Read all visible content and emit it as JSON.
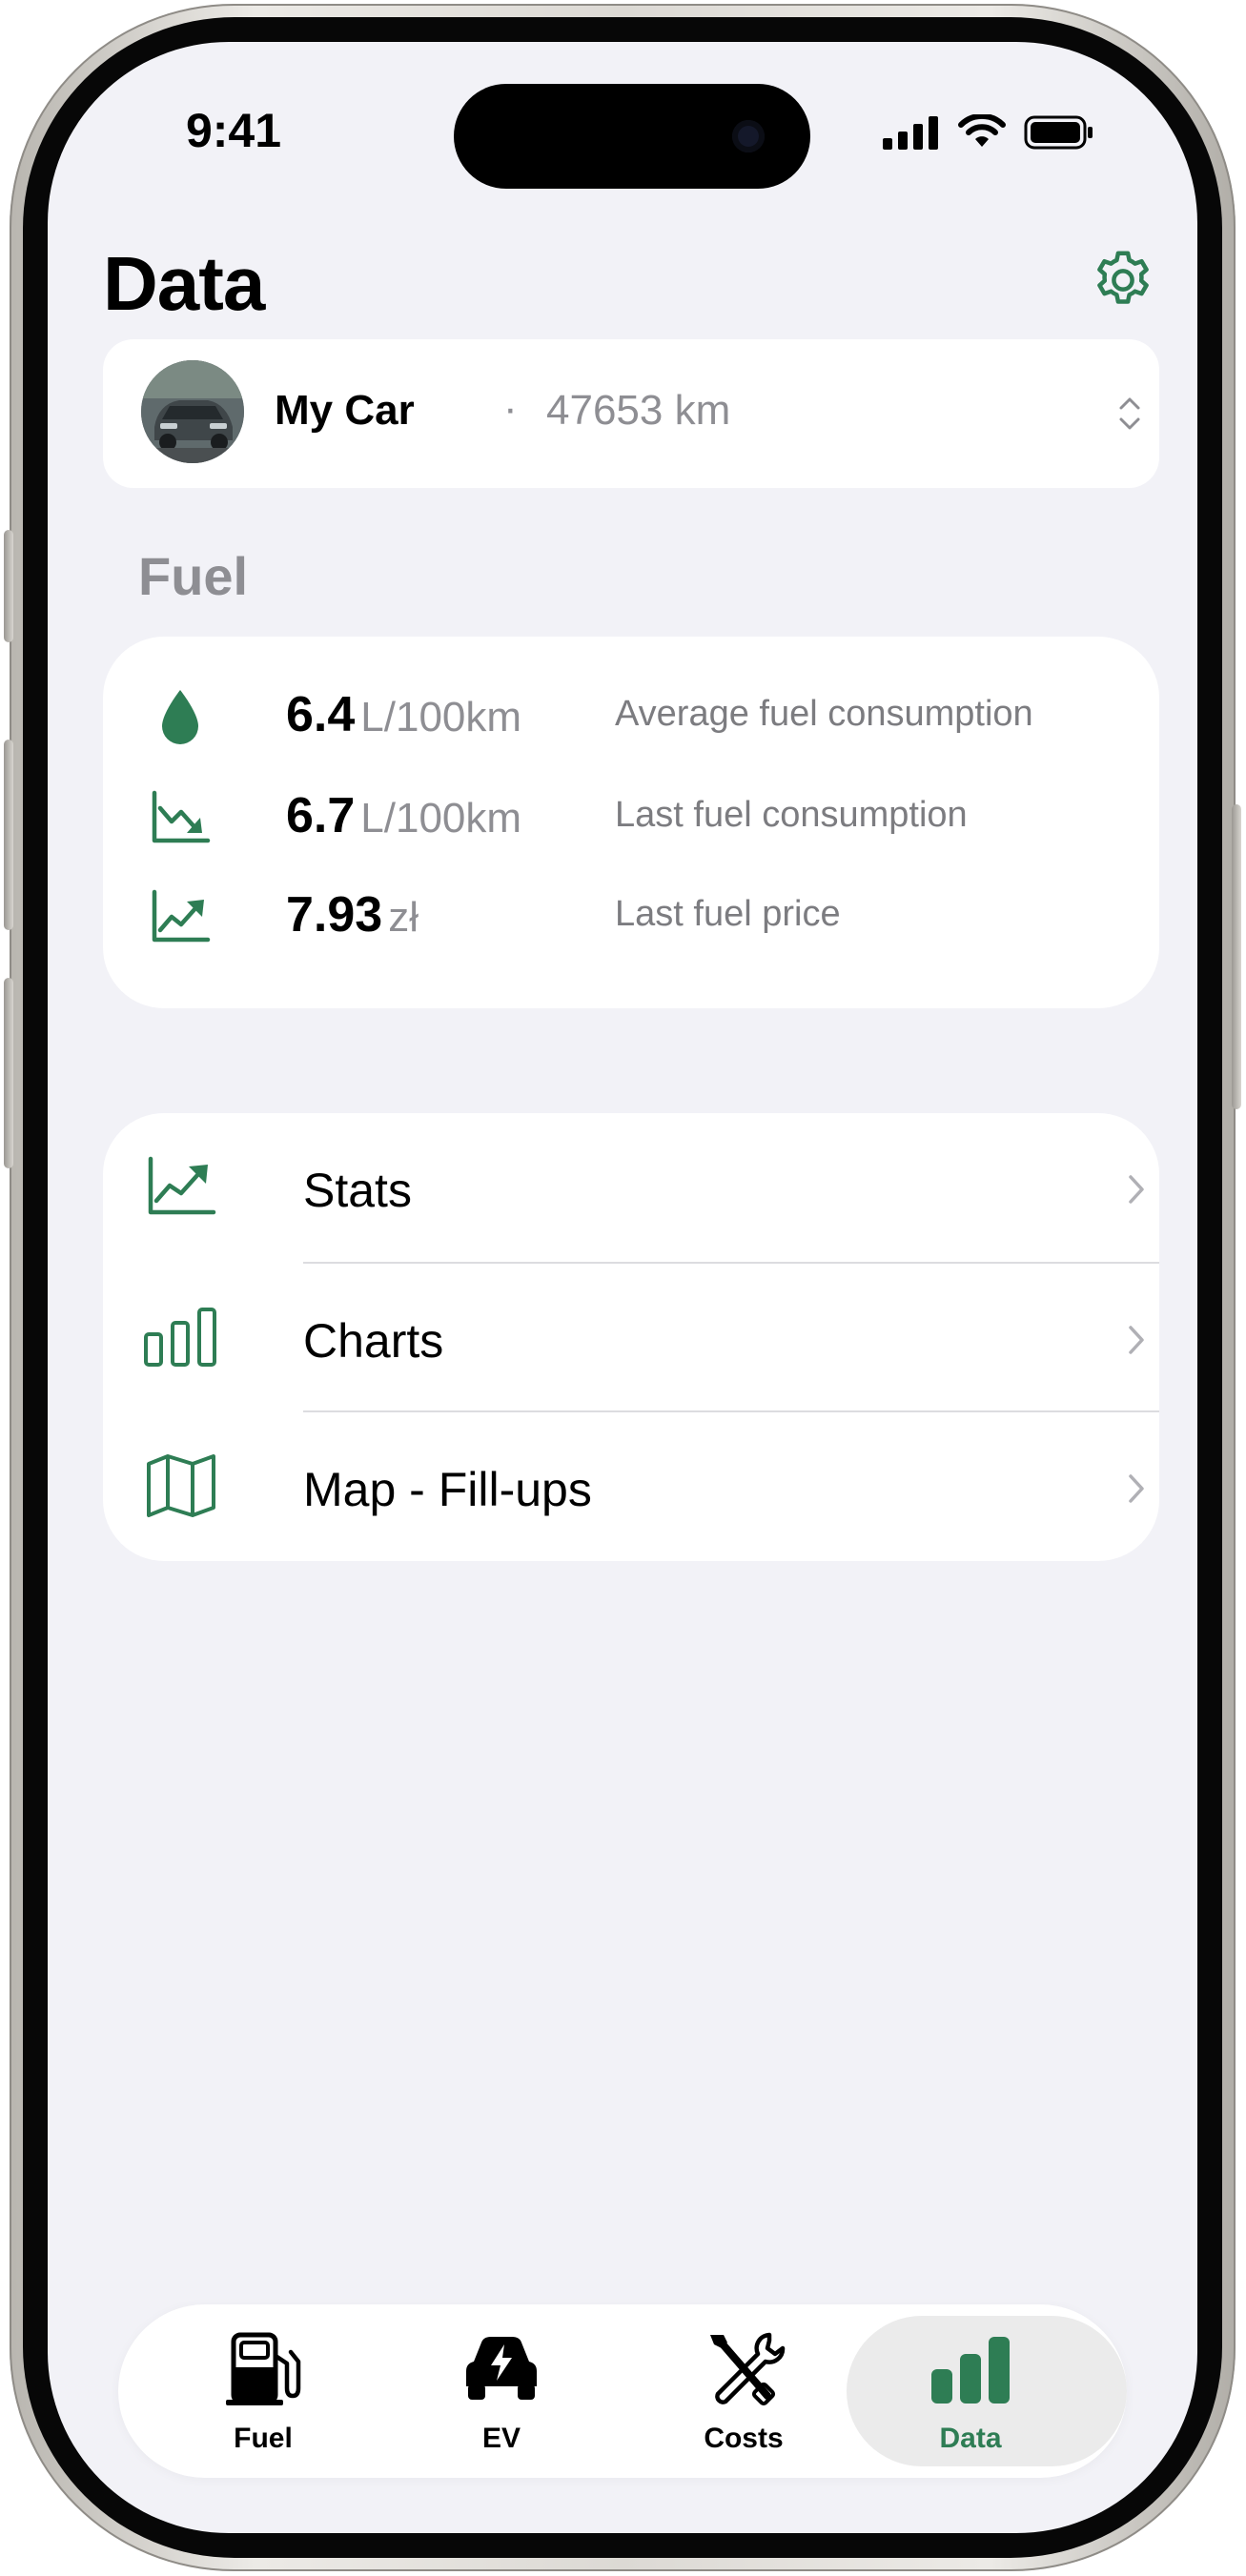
{
  "status_bar": {
    "time": "9:41"
  },
  "header": {
    "title": "Data"
  },
  "car": {
    "name": "My Car",
    "separator": "·",
    "odometer": "47653 km"
  },
  "section_title": "Fuel",
  "fuel_stats": [
    {
      "icon": "drop-icon",
      "value": "6.4",
      "unit": "L/100km",
      "label": "Average fuel consumption"
    },
    {
      "icon": "trend-down-icon",
      "value": "6.7",
      "unit": "L/100km",
      "label": "Last fuel consumption"
    },
    {
      "icon": "trend-up-icon",
      "value": "7.93",
      "unit": "zł",
      "label": "Last fuel price"
    }
  ],
  "menu": [
    {
      "icon": "trend-up-icon",
      "label": "Stats"
    },
    {
      "icon": "bar-chart-icon",
      "label": "Charts"
    },
    {
      "icon": "map-icon",
      "label": "Map - Fill-ups"
    }
  ],
  "tabs": [
    {
      "icon": "fuel-pump-icon",
      "label": "Fuel",
      "active": false
    },
    {
      "icon": "ev-car-icon",
      "label": "EV",
      "active": false
    },
    {
      "icon": "tools-icon",
      "label": "Costs",
      "active": false
    },
    {
      "icon": "data-bars-icon",
      "label": "Data",
      "active": true
    }
  ],
  "colors": {
    "accent": "#2e7d54",
    "background": "#f2f2f7",
    "secondary_text": "#8e8e93"
  }
}
